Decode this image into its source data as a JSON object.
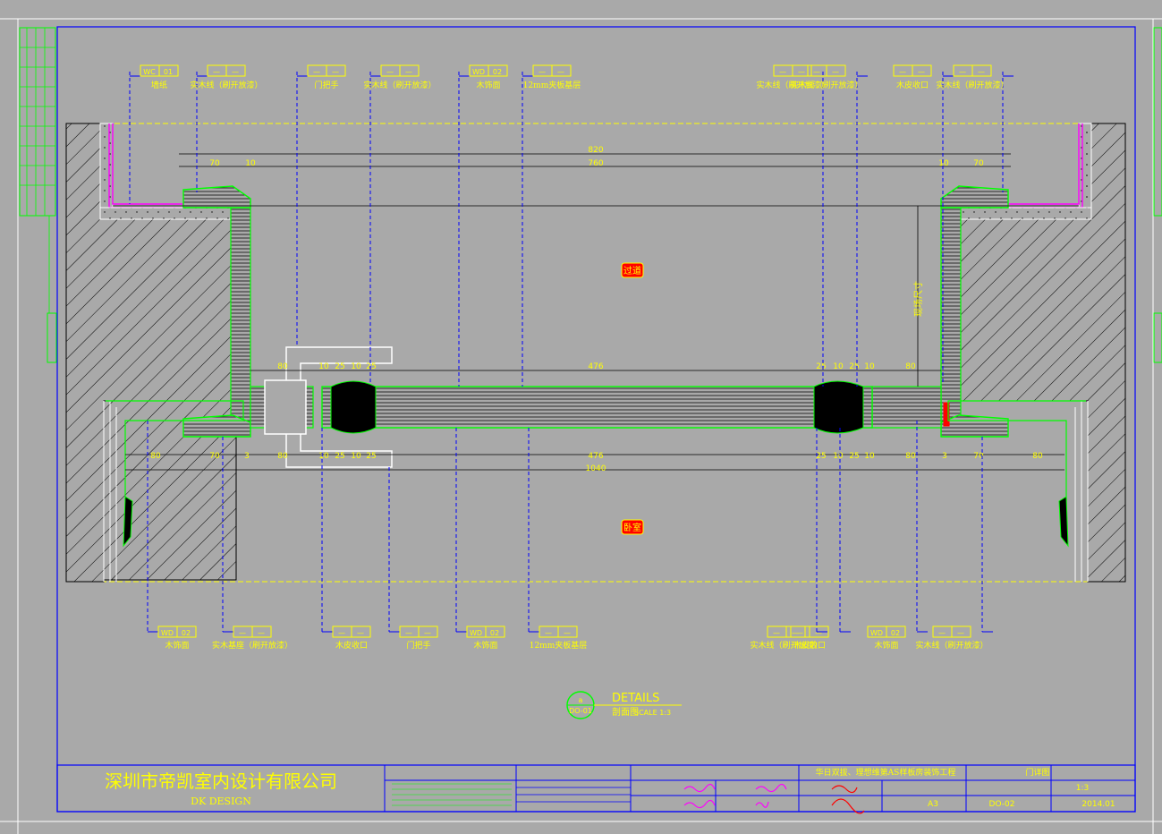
{
  "rooms": {
    "top": "过道",
    "bottom": "卧室"
  },
  "vertical_note": "现场尺寸",
  "details": {
    "title": "DETAILS",
    "subtitle": "剖面图",
    "scale": "SCALE  1:3",
    "circle_top": "a",
    "circle_bottom": "DO-01"
  },
  "company": {
    "name": "深圳市帝凯室内设计有限公司",
    "name_en": "DK    DESIGN"
  },
  "titleblock": {
    "project": "华日双拔、理想维第AS样板房装饰工程",
    "drawing_name": "门详图",
    "scale": "1:3",
    "paper": "A3",
    "drawing_no": "DO-02",
    "date": "2014.01"
  },
  "dims": {
    "top_total": "820",
    "top_inner": "760",
    "top_left_a": "70",
    "top_left_b": "10",
    "top_right_a": "10",
    "top_right_b": "70",
    "mid_top": [
      "80",
      "10",
      "25",
      "10",
      "25",
      "476",
      "25",
      "10",
      "25",
      "10",
      "80"
    ],
    "mid_bottom": [
      "80",
      "10",
      "25",
      "10",
      "25",
      "476",
      "25",
      "10",
      "25",
      "10",
      "80"
    ],
    "bot_total": "1040",
    "bot_left": [
      "80",
      "70",
      "3"
    ],
    "bot_right": [
      "3",
      "70",
      "80"
    ]
  },
  "callouts_top": [
    {
      "code": "WC",
      "num": "01",
      "label": "墙纸"
    },
    {
      "code": "—",
      "num": "—",
      "label": "实木线（刷开放漆）"
    },
    {
      "code": "—",
      "num": "—",
      "label": "门把手"
    },
    {
      "code": "—",
      "num": "—",
      "label": "实木线（刷开放漆）"
    },
    {
      "code": "WD",
      "num": "02",
      "label": "木饰面"
    },
    {
      "code": "—",
      "num": "—",
      "label": "12mm夹板基层"
    },
    {
      "code": "—",
      "num": "—",
      "label": "实木线（刷开放漆）"
    },
    {
      "code": "—",
      "num": "—",
      "label": "实木线（刷开放漆）"
    },
    {
      "code": "—",
      "num": "—",
      "label": "木皮收口"
    },
    {
      "code": "—",
      "num": "—",
      "label": "实木线（刷开放漆）"
    }
  ],
  "callouts_bottom": [
    {
      "code": "WD",
      "num": "02",
      "label": "木饰面"
    },
    {
      "code": "—",
      "num": "—",
      "label": "实木基座（刷开放漆）"
    },
    {
      "code": "—",
      "num": "—",
      "label": "木皮收口"
    },
    {
      "code": "—",
      "num": "—",
      "label": "门把手"
    },
    {
      "code": "WD",
      "num": "02",
      "label": "木饰面"
    },
    {
      "code": "—",
      "num": "—",
      "label": "12mm夹板基层"
    },
    {
      "code": "—",
      "num": "—",
      "label": "实木线（刷开放漆）"
    },
    {
      "code": "—",
      "num": "—",
      "label": "木皮收口"
    },
    {
      "code": "WD",
      "num": "02",
      "label": "木饰面"
    },
    {
      "code": "—",
      "num": "—",
      "label": "实木线（刷开放漆）"
    }
  ],
  "colors": {
    "background": "#a9a9a9",
    "frame": "#0000ff",
    "text": "#ffff00",
    "profile": "#00ff00",
    "wall": "#000000",
    "accent": "#ff00ff",
    "room_tag": "#ff0000",
    "leader": "#0000ff"
  }
}
